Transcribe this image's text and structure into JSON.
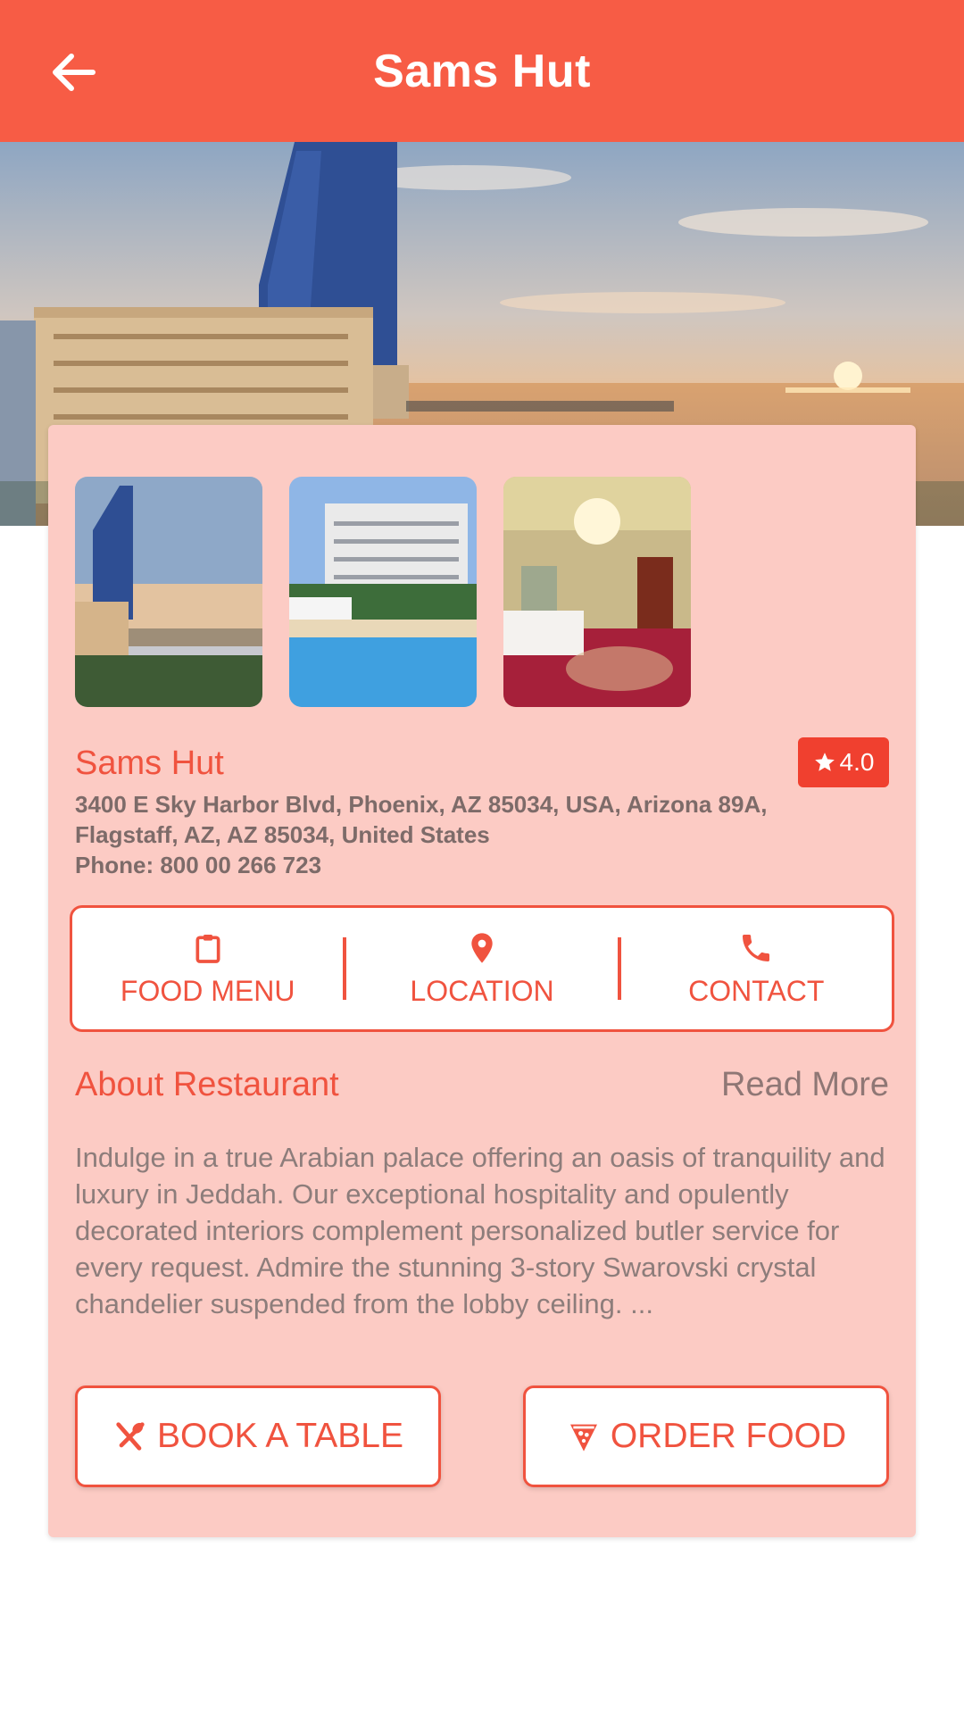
{
  "header": {
    "title": "Sams Hut",
    "back_icon": "arrow-left-icon"
  },
  "colors": {
    "primary": "#f75c45",
    "accent": "#f0533f",
    "card_bg": "#fccbc4"
  },
  "restaurant": {
    "name": "Sams Hut",
    "rating": "4.0",
    "address_line1": "3400 E Sky Harbor Blvd, Phoenix, AZ 85034, USA, Arizona 89A,",
    "address_line2": "Flagstaff, AZ, AZ 85034, United States",
    "phone": "Phone: 800 00 266 723"
  },
  "actions": [
    {
      "label": "FOOD MENU",
      "icon": "clipboard-icon"
    },
    {
      "label": "LOCATION",
      "icon": "map-pin-icon"
    },
    {
      "label": "CONTACT",
      "icon": "phone-icon"
    }
  ],
  "about": {
    "title": "About Restaurant",
    "read_more": "Read More",
    "text": "Indulge in a true Arabian palace offering an oasis of tranquility and luxury in Jeddah. Our exceptional hospitality and opulently decorated interiors complement personalized butler service for every request. Admire the stunning 3-story Swarovski crystal chandelier suspended from the lobby ceiling. ..."
  },
  "buttons": {
    "book": {
      "label": "BOOK A TABLE",
      "icon": "cutlery-icon"
    },
    "order": {
      "label": "ORDER FOOD",
      "icon": "pizza-icon"
    }
  }
}
